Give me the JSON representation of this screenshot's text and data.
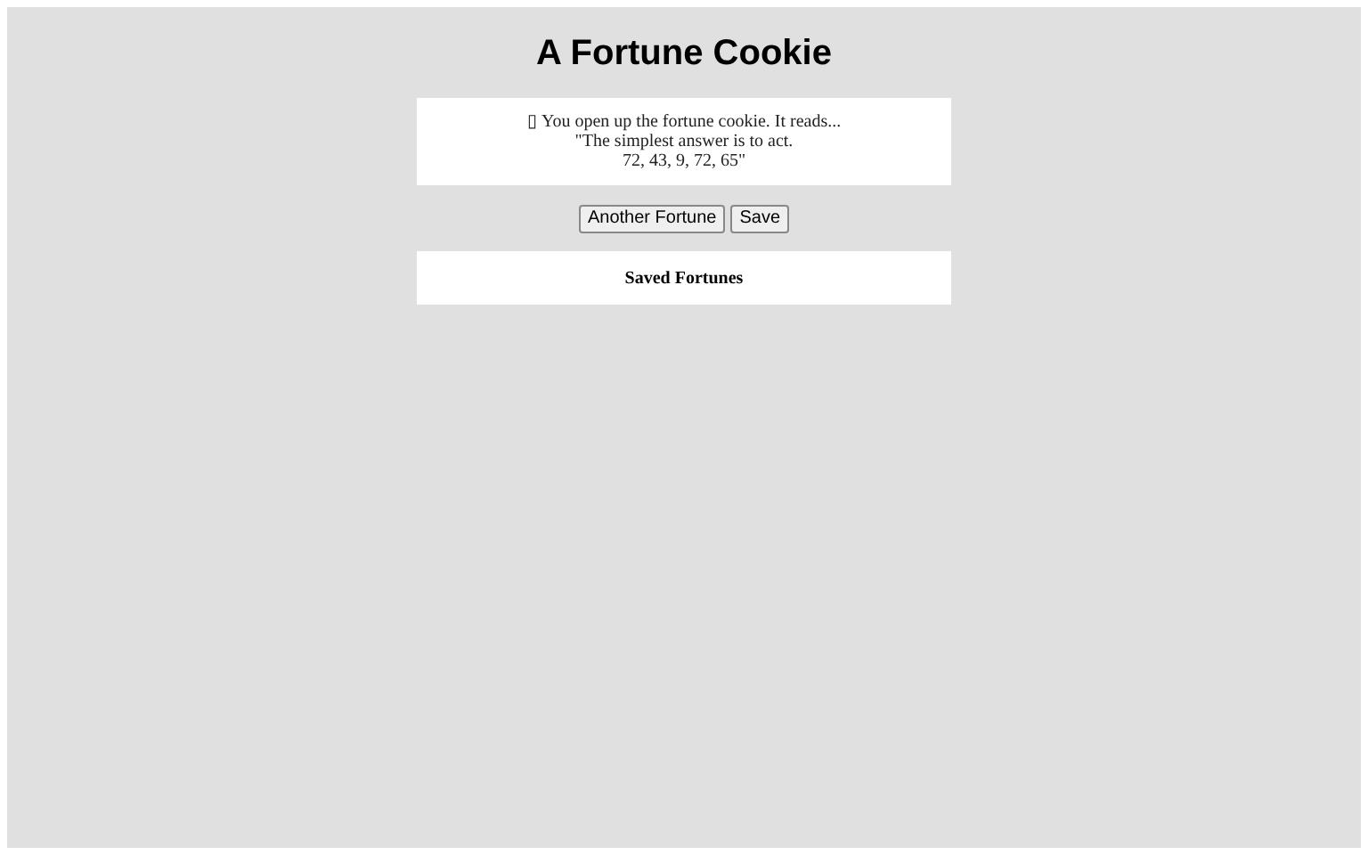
{
  "title": "A Fortune Cookie",
  "fortune": {
    "lines": [
      "▯ You open up the fortune cookie. It reads...",
      "\"The simplest answer is to act.",
      "72, 43, 9, 72, 65\""
    ]
  },
  "buttons": [
    "Another Fortune",
    "Save"
  ],
  "saved": {
    "heading": "Saved Fortunes"
  }
}
